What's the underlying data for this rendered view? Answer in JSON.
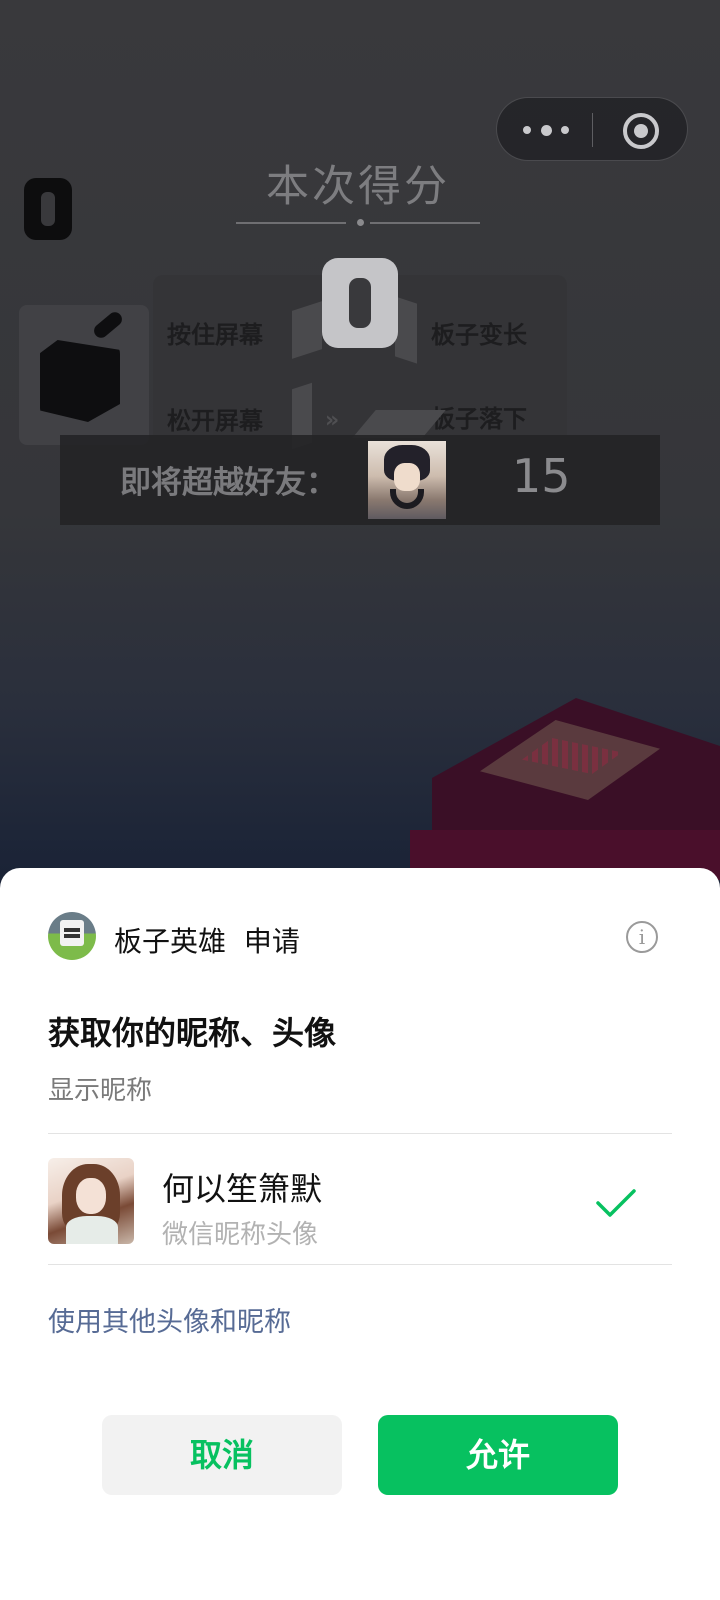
{
  "game": {
    "small_score": "0",
    "score_title": "本次得分",
    "current_score": "0",
    "tutorial": {
      "press_label": "按住屏幕",
      "grow_label": "板子变长",
      "release_label": "松开屏幕",
      "drop_label": "板子落下",
      "arrows": "»"
    },
    "friend_bar": {
      "label": "即将超越好友：",
      "friend_score": "15"
    }
  },
  "capsule": {
    "more_icon": "more-dots-icon",
    "close_icon": "target-circle-icon"
  },
  "sheet": {
    "app_name": "板子英雄",
    "request_word": "申请",
    "info_icon": "info-icon",
    "title": "获取你的昵称、头像",
    "description": "显示昵称",
    "user": {
      "nickname": "何以笙箫默",
      "subtitle": "微信昵称头像",
      "selected": true
    },
    "other_link": "使用其他头像和昵称",
    "cancel_label": "取消",
    "allow_label": "允许"
  },
  "colors": {
    "accent_green": "#07c160",
    "link_blue": "#576b95"
  }
}
